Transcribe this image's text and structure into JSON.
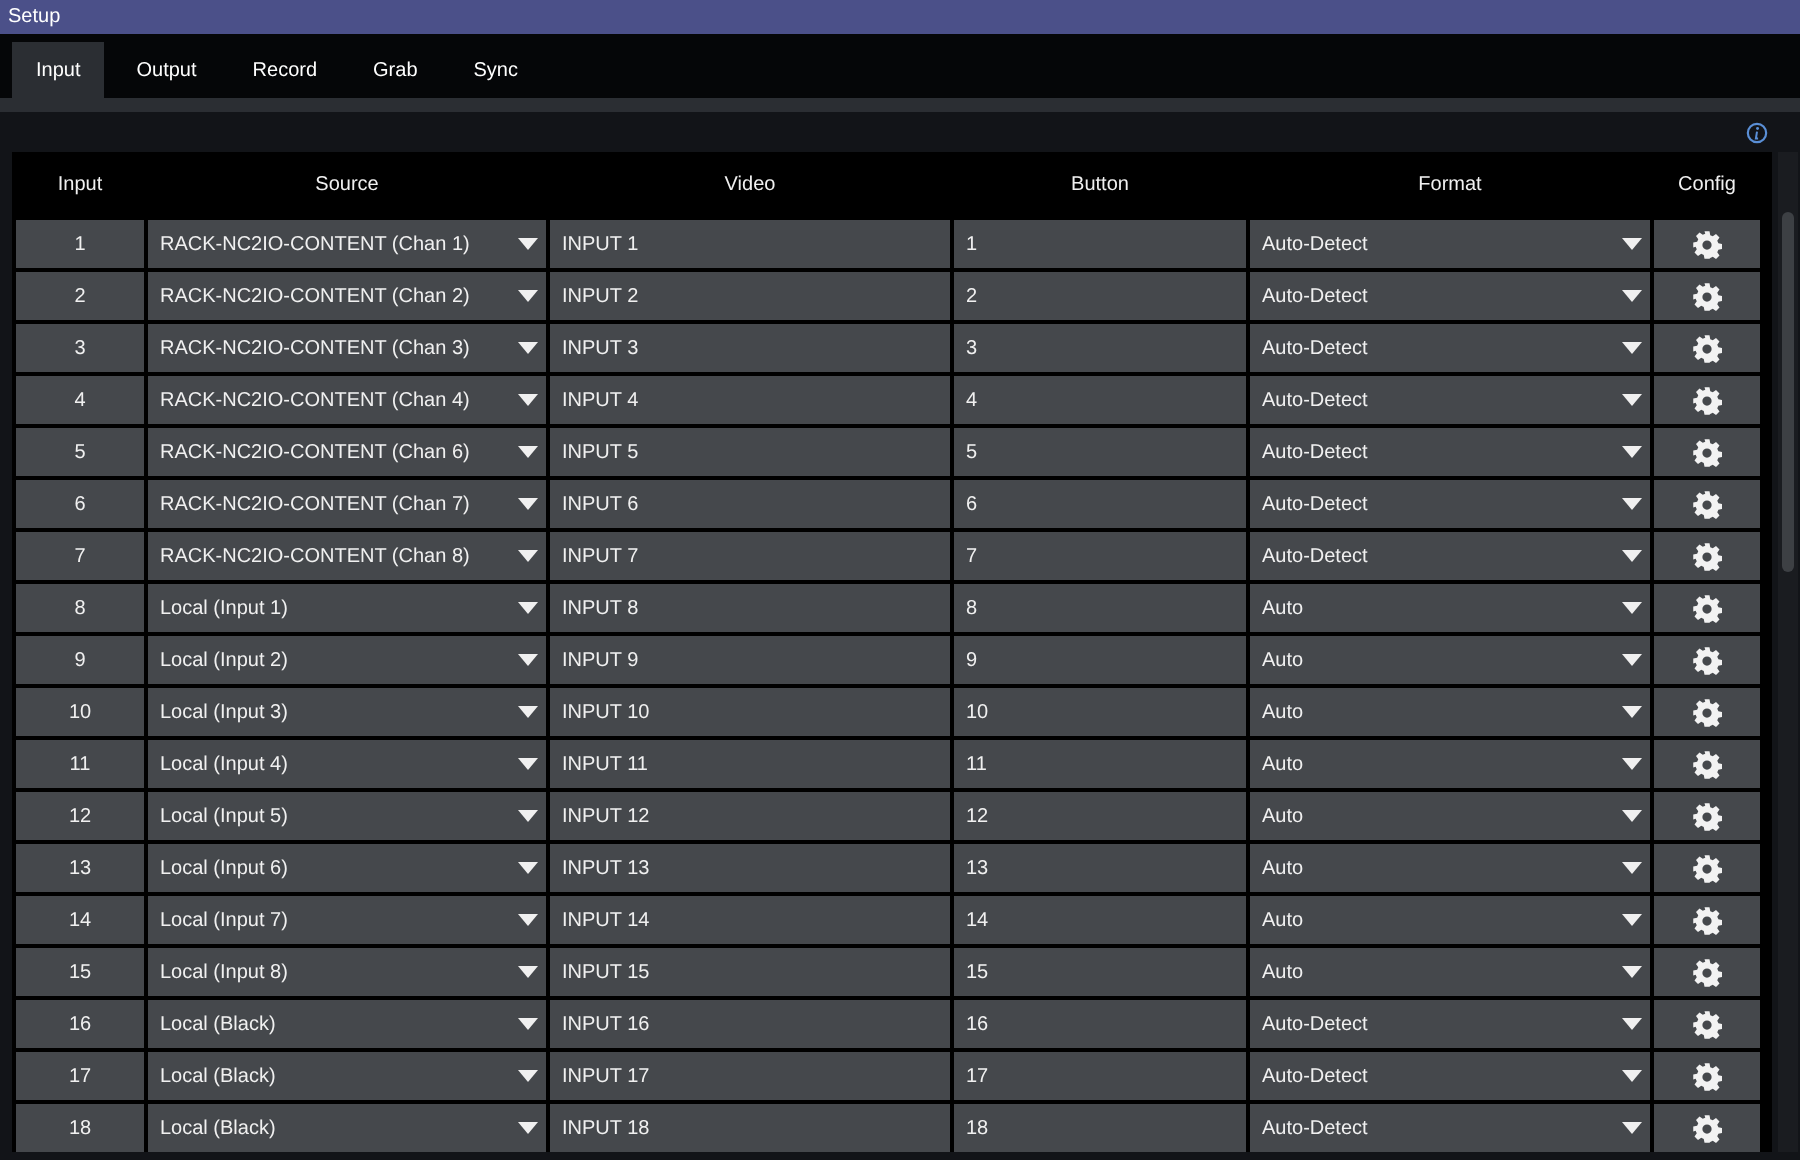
{
  "window": {
    "title": "Setup"
  },
  "tabs": [
    {
      "label": "Input",
      "selected": true
    },
    {
      "label": "Output",
      "selected": false
    },
    {
      "label": "Record",
      "selected": false
    },
    {
      "label": "Grab",
      "selected": false
    },
    {
      "label": "Sync",
      "selected": false
    }
  ],
  "table": {
    "columns": [
      "Input",
      "Source",
      "Video",
      "Button",
      "Format",
      "Config"
    ],
    "rows": [
      {
        "input": "1",
        "source": "RACK-NC2IO-CONTENT (Chan 1)",
        "video": "INPUT 1",
        "button": "1",
        "format": "Auto-Detect"
      },
      {
        "input": "2",
        "source": "RACK-NC2IO-CONTENT (Chan 2)",
        "video": "INPUT 2",
        "button": "2",
        "format": "Auto-Detect"
      },
      {
        "input": "3",
        "source": "RACK-NC2IO-CONTENT (Chan 3)",
        "video": "INPUT 3",
        "button": "3",
        "format": "Auto-Detect"
      },
      {
        "input": "4",
        "source": "RACK-NC2IO-CONTENT (Chan 4)",
        "video": "INPUT 4",
        "button": "4",
        "format": "Auto-Detect"
      },
      {
        "input": "5",
        "source": "RACK-NC2IO-CONTENT (Chan 6)",
        "video": "INPUT 5",
        "button": "5",
        "format": "Auto-Detect"
      },
      {
        "input": "6",
        "source": "RACK-NC2IO-CONTENT (Chan 7)",
        "video": "INPUT 6",
        "button": "6",
        "format": "Auto-Detect"
      },
      {
        "input": "7",
        "source": "RACK-NC2IO-CONTENT (Chan 8)",
        "video": "INPUT 7",
        "button": "7",
        "format": "Auto-Detect"
      },
      {
        "input": "8",
        "source": "Local (Input 1)",
        "video": "INPUT 8",
        "button": "8",
        "format": "Auto"
      },
      {
        "input": "9",
        "source": "Local (Input 2)",
        "video": "INPUT 9",
        "button": "9",
        "format": "Auto"
      },
      {
        "input": "10",
        "source": "Local (Input 3)",
        "video": "INPUT 10",
        "button": "10",
        "format": "Auto"
      },
      {
        "input": "11",
        "source": "Local (Input 4)",
        "video": "INPUT 11",
        "button": "11",
        "format": "Auto"
      },
      {
        "input": "12",
        "source": "Local (Input 5)",
        "video": "INPUT 12",
        "button": "12",
        "format": "Auto"
      },
      {
        "input": "13",
        "source": "Local (Input 6)",
        "video": "INPUT 13",
        "button": "13",
        "format": "Auto"
      },
      {
        "input": "14",
        "source": "Local (Input 7)",
        "video": "INPUT 14",
        "button": "14",
        "format": "Auto"
      },
      {
        "input": "15",
        "source": "Local (Input 8)",
        "video": "INPUT 15",
        "button": "15",
        "format": "Auto"
      },
      {
        "input": "16",
        "source": "Local (Black)",
        "video": "INPUT 16",
        "button": "16",
        "format": "Auto-Detect"
      },
      {
        "input": "17",
        "source": "Local (Black)",
        "video": "INPUT 17",
        "button": "17",
        "format": "Auto-Detect"
      },
      {
        "input": "18",
        "source": "Local (Black)",
        "video": "INPUT 18",
        "button": "18",
        "format": "Auto-Detect"
      }
    ]
  }
}
